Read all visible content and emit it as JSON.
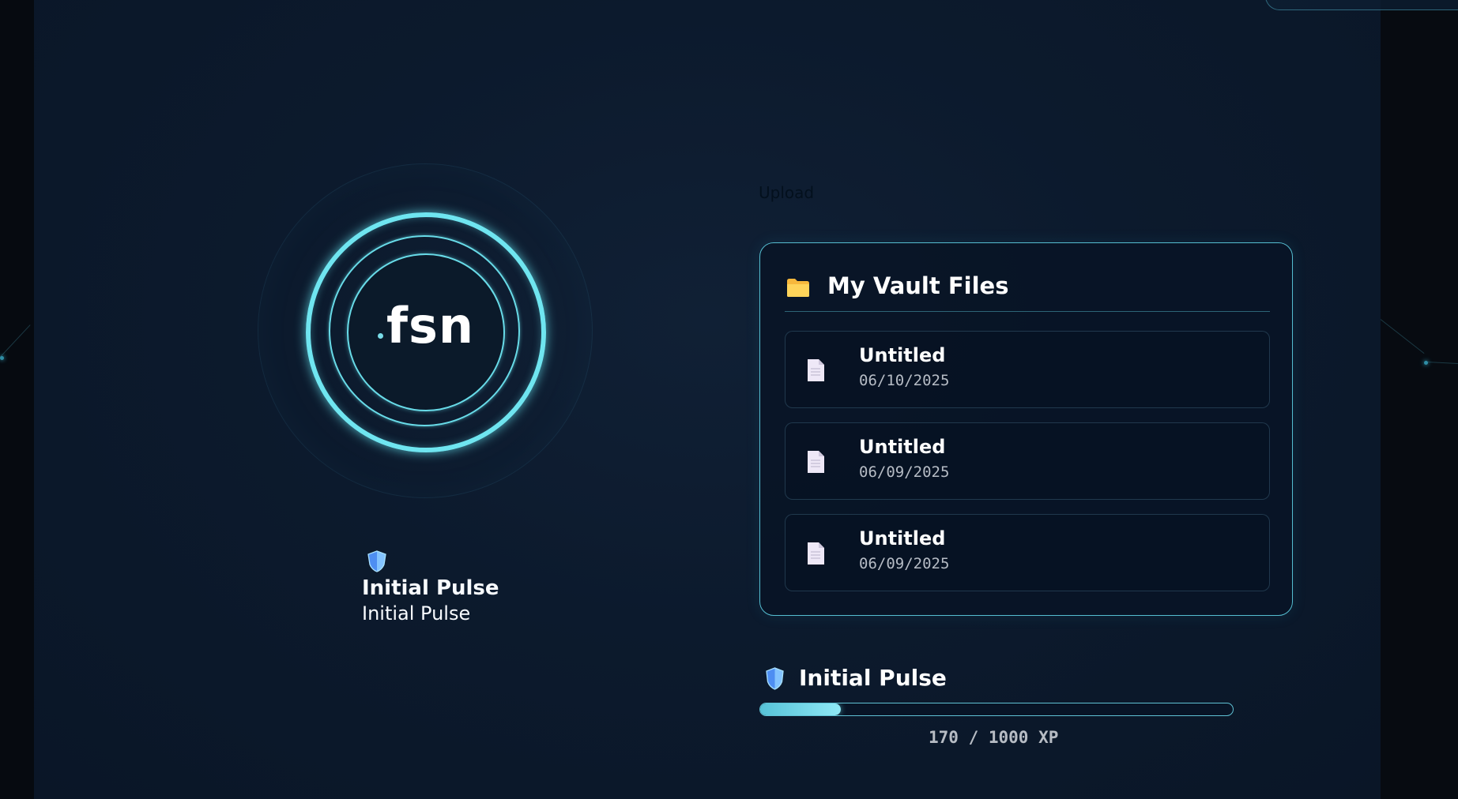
{
  "brand": {
    "logo_text": "fsn"
  },
  "upload": {
    "label": "Upload"
  },
  "vault": {
    "title": "My Vault Files",
    "files": [
      {
        "name": "Untitled",
        "date": "06/10/2025"
      },
      {
        "name": "Untitled",
        "date": "06/09/2025"
      },
      {
        "name": "Untitled",
        "date": "06/09/2025"
      }
    ]
  },
  "rank": {
    "title": "Initial Pulse",
    "subtitle": "Initial Pulse"
  },
  "progress": {
    "title": "Initial Pulse",
    "current_xp": 170,
    "max_xp": 1000,
    "xp_text": "170 / 1000 XP",
    "fill_percent": 17
  },
  "colors": {
    "accent": "#6fe5f0",
    "background": "#0c1a2d",
    "folder": "#ffcc4d",
    "shield": "#5aa7ff"
  },
  "icons": {
    "folder": "folder-icon",
    "file": "file-icon",
    "shield": "shield-icon"
  }
}
